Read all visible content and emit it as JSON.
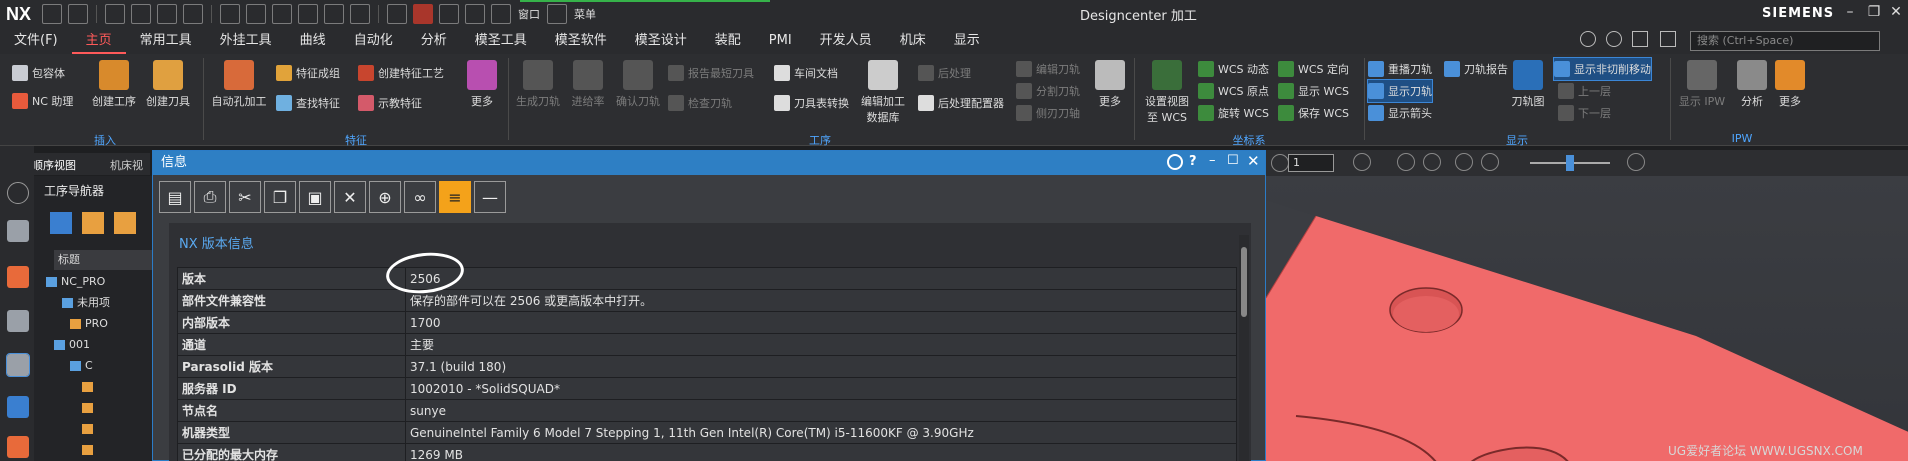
{
  "app": {
    "logo": "NX",
    "title": "Designcenter 加工",
    "brand": "SIEMENS",
    "quick_access_window": "窗口",
    "quick_access_menu": "菜单"
  },
  "menu": {
    "items": [
      "文件(F)",
      "主页",
      "常用工具",
      "外挂工具",
      "曲线",
      "自动化",
      "分析",
      "模圣工具",
      "模圣软件",
      "模圣设计",
      "装配",
      "PMI",
      "开发人员",
      "机床",
      "显示"
    ],
    "active_index": 1,
    "search_placeholder": "搜索 (Ctrl+Space)"
  },
  "ribbon": {
    "groups": {
      "insert": "插入",
      "feature": "特征",
      "process": "工序",
      "coord": "坐标系",
      "display": "显示",
      "ipw": "IPW"
    },
    "insert": {
      "bulk_container": "包容体",
      "nc_assistant": "NC 助理",
      "create_op": "创建工序",
      "create_tool": "创建刀具"
    },
    "feature": {
      "auto_hole": "自动孔加工",
      "feature_group": "特征成组",
      "find_feature": "查找特征",
      "create_feature_proc": "创建特征工艺",
      "teach_feature": "示教特征",
      "more": "更多"
    },
    "process": {
      "gen_toolpath": "生成刀轨",
      "feed_rate": "进给率",
      "verify_toolpath": "确认刀轨",
      "report_shortest": "报告最短刀具",
      "check_toolpath": "检查刀轨",
      "shop_doc": "车间文档",
      "tool_convert": "刀具表转换",
      "edit_tool_lib_1": "编辑加工",
      "edit_tool_lib_2": "数据库",
      "postprocess": "后处理",
      "post_config": "后处理配置器",
      "edit_toolpath": "编辑刀轨",
      "split_toolpath": "分割刀轨",
      "side_blade": "侧刃刀轴",
      "more": "更多"
    },
    "coord": {
      "set_view_1": "设置视图",
      "set_view_2": "至 WCS",
      "wcs_dynamic": "WCS 动态",
      "wcs_origin": "WCS 原点",
      "rotate_wcs": "旋转 WCS",
      "wcs_orient": "WCS 定向",
      "show_wcs": "显示 WCS",
      "save_wcs": "保存 WCS"
    },
    "display": {
      "replay_toolpath": "重播刀轨",
      "show_toolpath": "显示刀轨",
      "show_arrow": "显示箭头",
      "toolpath_report": "刀轨报告",
      "toolpath_chart": "刀轨图",
      "show_noncut": "显示非切削移动",
      "up_level": "上一层",
      "down_level": "下一层"
    },
    "ipw": {
      "show_ipw": "显示 IPW",
      "analysis": "分析",
      "more": "更多"
    }
  },
  "nav": {
    "tab_program_order": "程序顺序视图",
    "tab_machine": "机床视",
    "navigator_title": "工序导航器",
    "column_header": "标题",
    "tree": [
      "NC_PRO",
      "未用项",
      "PRO",
      "001",
      "C",
      "",
      "",
      "",
      ""
    ]
  },
  "view_toolbar": {
    "layer_value": "1"
  },
  "dialog": {
    "title": "信息",
    "help": "?",
    "section_title": "NX 版本信息",
    "rows": [
      {
        "key": "版本",
        "value": "2506"
      },
      {
        "key": "部件文件兼容性",
        "value": "保存的部件可以在 2506 或更高版本中打开。"
      },
      {
        "key": "内部版本",
        "value": "1700"
      },
      {
        "key": "通道",
        "value": "主要"
      },
      {
        "key": "Parasolid 版本",
        "value": "37.1 (build 180)"
      },
      {
        "key": "服务器 ID",
        "value": "1002010 - *SolidSQUAD*"
      },
      {
        "key": "节点名",
        "value": "sunye"
      },
      {
        "key": "机器类型",
        "value": "GenuineIntel Family 6 Model 7 Stepping 1, 11th Gen Intel(R) Core(TM) i5-11600KF @ 3.90GHz"
      },
      {
        "key": "已分配的最大内存",
        "value": "1269 MB"
      }
    ]
  },
  "watermark": "UG爱好者论坛 WWW.UGSNX.COM",
  "colors": {
    "accent_red": "#ff5a5a",
    "dialog_blue": "#2e7fc4",
    "part_red": "#f06a6a",
    "group_label_blue": "#4fa6ff"
  }
}
